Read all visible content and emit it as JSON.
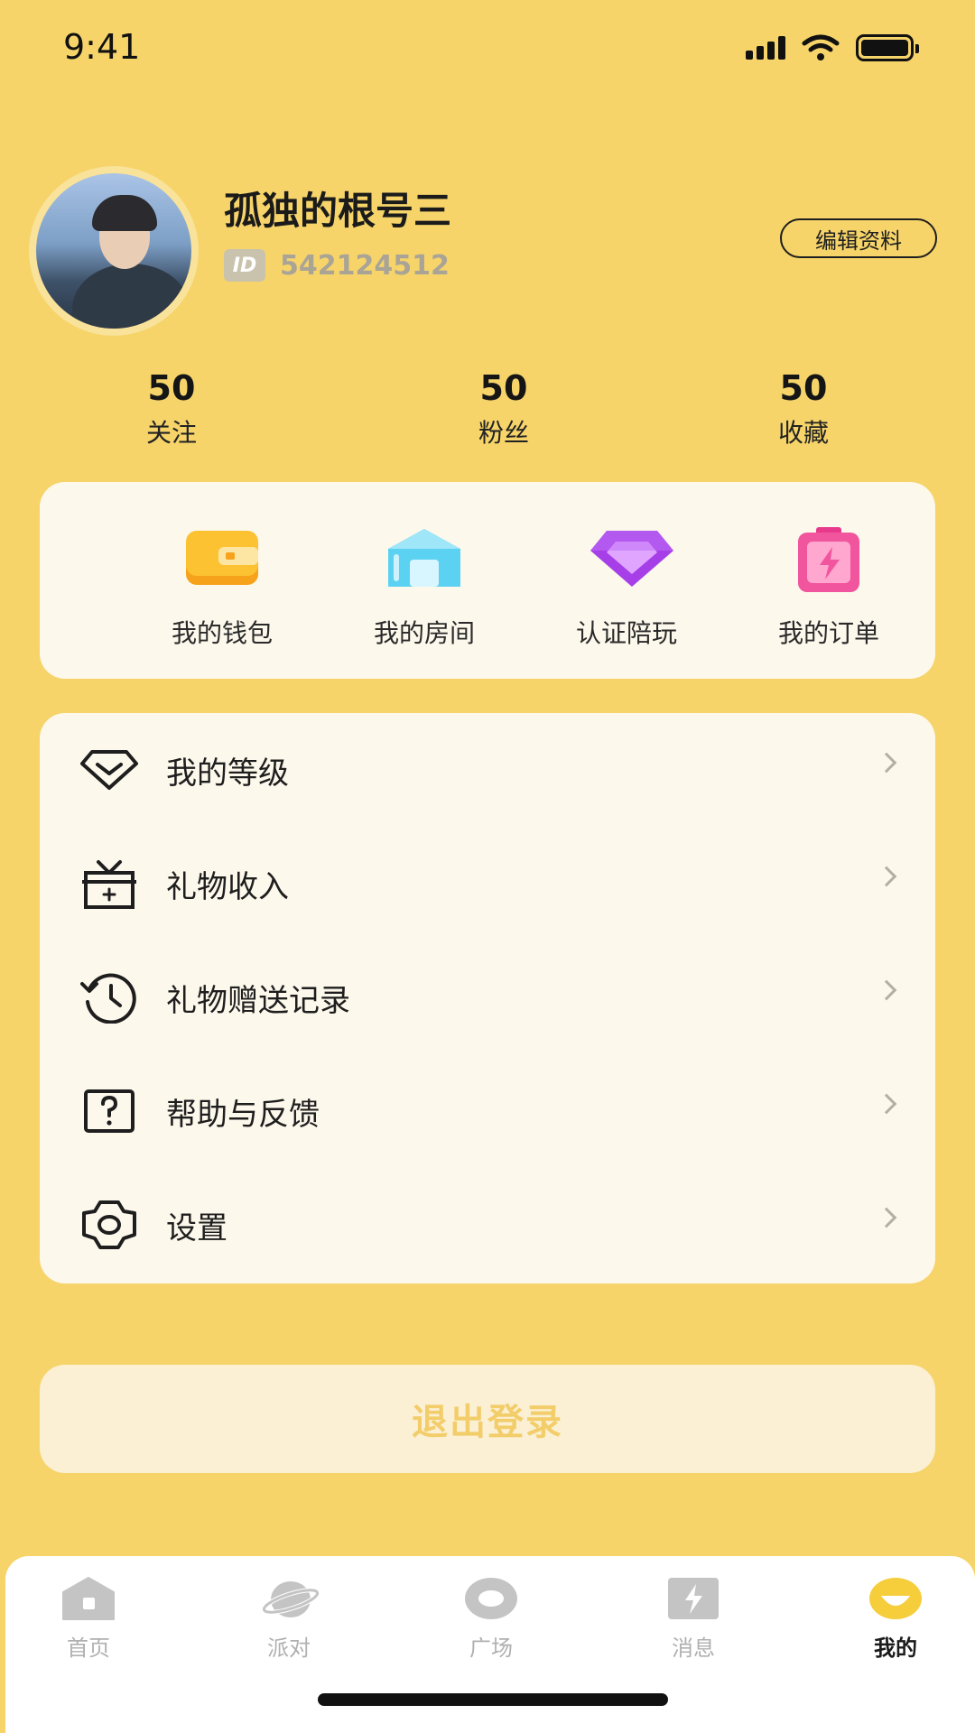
{
  "status_bar": {
    "time": "9:41"
  },
  "profile": {
    "username": "孤独的根号三",
    "id_badge": "ID",
    "id_value": "542124512",
    "edit_label": "编辑资料"
  },
  "stats": [
    {
      "value": "50",
      "label": "关注"
    },
    {
      "value": "50",
      "label": "粉丝"
    },
    {
      "value": "50",
      "label": "收藏"
    }
  ],
  "quick_actions": [
    {
      "label": "我的钱包",
      "icon": "wallet-icon"
    },
    {
      "label": "我的房间",
      "icon": "room-icon"
    },
    {
      "label": "认证陪玩",
      "icon": "diamond-icon"
    },
    {
      "label": "我的订单",
      "icon": "order-icon"
    }
  ],
  "menu": [
    {
      "label": "我的等级",
      "icon": "level-icon"
    },
    {
      "label": "礼物收入",
      "icon": "gift-icon"
    },
    {
      "label": "礼物赠送记录",
      "icon": "history-icon"
    },
    {
      "label": "帮助与反馈",
      "icon": "help-icon"
    },
    {
      "label": "设置",
      "icon": "settings-icon"
    }
  ],
  "logout_label": "退出登录",
  "tabs": [
    {
      "label": "首页",
      "icon": "home-icon",
      "active": false
    },
    {
      "label": "派对",
      "icon": "party-icon",
      "active": false
    },
    {
      "label": "广场",
      "icon": "plaza-icon",
      "active": false
    },
    {
      "label": "消息",
      "icon": "message-icon",
      "active": false
    },
    {
      "label": "我的",
      "icon": "profile-icon",
      "active": true
    }
  ],
  "colors": {
    "background": "#f6d46a",
    "card": "#fdf8ec",
    "logout_text": "#f2cd6a",
    "inactive_tab": "#b0b0b0"
  }
}
